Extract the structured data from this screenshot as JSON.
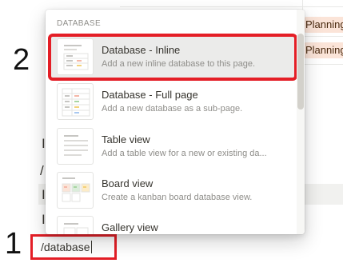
{
  "annotations": {
    "step_one": "1",
    "step_two": "2"
  },
  "background": {
    "tags": [
      "Planning",
      "Planning"
    ],
    "fragments": [
      "I",
      "/",
      "I",
      "I"
    ]
  },
  "command_input": {
    "value": "/database"
  },
  "menu": {
    "section_label": "DATABASE",
    "items": [
      {
        "title": "Database - Inline",
        "description": "Add a new inline database to this page.",
        "icon": "inline-database-thumbnail-icon"
      },
      {
        "title": "Database - Full page",
        "description": "Add a new database as a sub-page.",
        "icon": "full-page-database-thumbnail-icon"
      },
      {
        "title": "Table view",
        "description": "Add a table view for a new or existing da...",
        "icon": "table-view-thumbnail-icon"
      },
      {
        "title": "Board view",
        "description": "Create a kanban board database view.",
        "icon": "board-view-thumbnail-icon"
      },
      {
        "title": "Gallery view",
        "description": "",
        "icon": "gallery-view-thumbnail-icon"
      }
    ]
  },
  "colors": {
    "highlight_red": "#e41e26",
    "tag_background": "#fbe4d8",
    "active_item_background": "#ebebea"
  }
}
